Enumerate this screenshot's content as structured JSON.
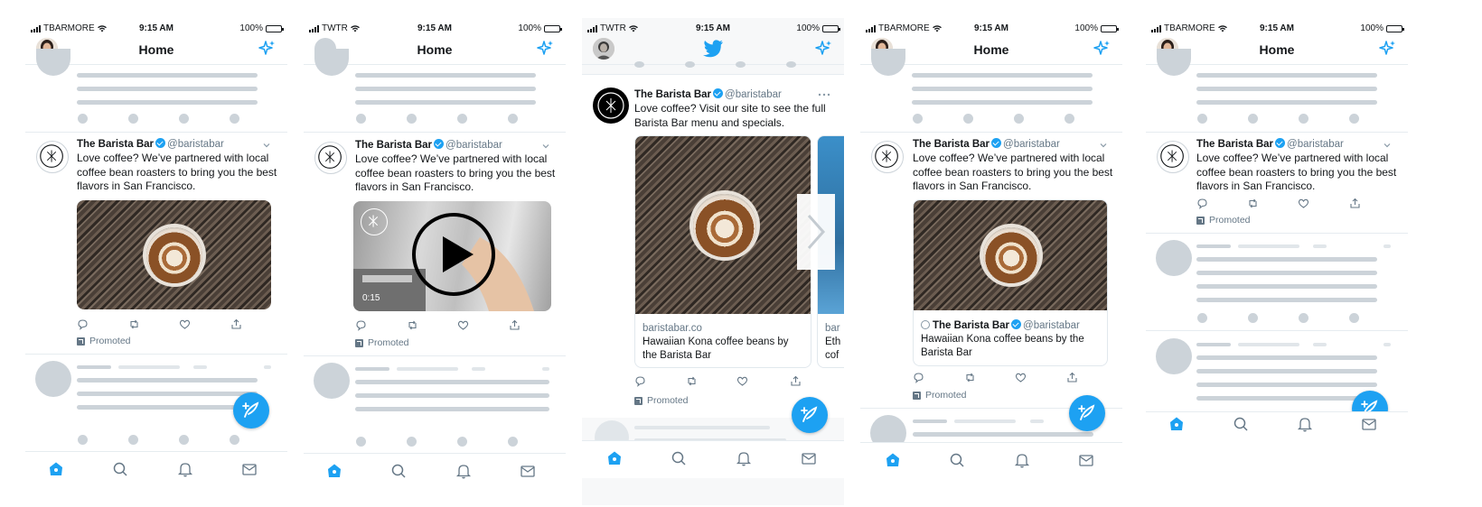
{
  "colors": {
    "brand_blue": "#1da1f2",
    "skeleton": "#ccd3d9",
    "secondary_text": "#657786"
  },
  "status_bar": {
    "time": "9:15 AM",
    "battery": "100%",
    "carriers": [
      "TBARMORE",
      "TWTR",
      "TWTR",
      "TBARMORE",
      "TBARMORE"
    ]
  },
  "nav": {
    "title": "Home"
  },
  "tweet": {
    "name": "The Barista Bar",
    "handle": "@baristabar",
    "text": "Love coffee? We’ve partnered with local coffee bean roasters to bring you the best flavors in San Francisco.",
    "carousel_text": "Love coffee? Visit our site to see the full Barista Bar menu and specials.",
    "promoted": "Promoted"
  },
  "video": {
    "duration": "0:15"
  },
  "carousel": {
    "card_domain": "baristabar.co",
    "card_title": "Hawaiian Kona coffee beans by the Barista Bar",
    "next_card_domain": "bar",
    "next_card_title_1": "Eth",
    "next_card_title_2": "cof"
  },
  "card4": {
    "name": "The Barista Bar",
    "handle": "@baristabar",
    "title": "Hawaiian Kona coffee beans by the Barista Bar"
  },
  "icons": [
    "home-icon",
    "search-icon",
    "bell-icon",
    "mail-icon",
    "sparkle-icon",
    "compose-icon",
    "reply-icon",
    "retweet-icon",
    "like-icon",
    "share-icon",
    "play-icon",
    "twitter-bird-icon"
  ]
}
